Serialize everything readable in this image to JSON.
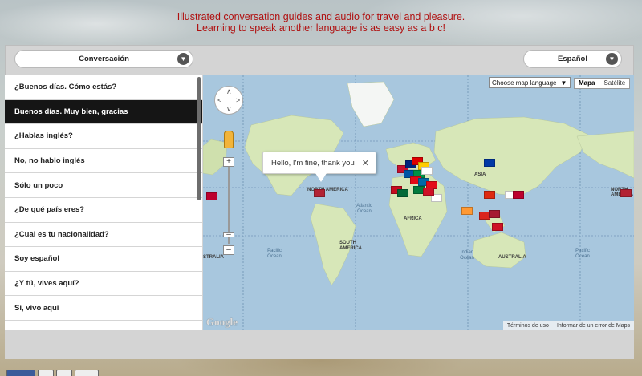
{
  "header": {
    "tagline_line1": "Illustrated conversation guides and audio for travel and pleasure.",
    "tagline_line2": "Learning to speak another language is as easy as a b c!"
  },
  "category_select": {
    "label": "Conversación",
    "icon": "chevron-down-icon"
  },
  "language_select": {
    "label": "Español",
    "icon": "chevron-down-icon"
  },
  "phrases": [
    "¿Buenos días. Cómo estás?",
    "Buenos días. Muy bien, gracias",
    "¿Hablas inglés?",
    "No, no hablo inglés",
    "Sólo un poco",
    "¿De qué país eres?",
    "¿Cual es tu nacionalidad?",
    "Soy español",
    "¿Y tú, vives aquí?",
    "Sí, vivo aquí"
  ],
  "selected_phrase_index": 1,
  "map": {
    "language_dropdown": "Choose map language",
    "map_type_map": "Mapa",
    "map_type_satellite": "Satélite",
    "info_window_text": "Hello, I'm fine, thank you",
    "close_symbol": "✕",
    "regions": {
      "north_america_left": "NORTH AMERICA",
      "north_america_right": "NORTH AMERICA",
      "south_america": "SOUTH AMERICA",
      "africa": "AFRICA",
      "asia": "ASIA",
      "australia": "AUSTRALIA",
      "australia_left": "STRALIA"
    },
    "oceans": {
      "atlantic": "Atlantic Ocean",
      "pacific_left": "Pacific Ocean",
      "indian": "Indian Ocean",
      "pacific_right": "Pacific Ocean"
    },
    "logo": "Google",
    "footer_terms": "Términos de uso",
    "footer_report": "Informar de un error de Maps"
  }
}
